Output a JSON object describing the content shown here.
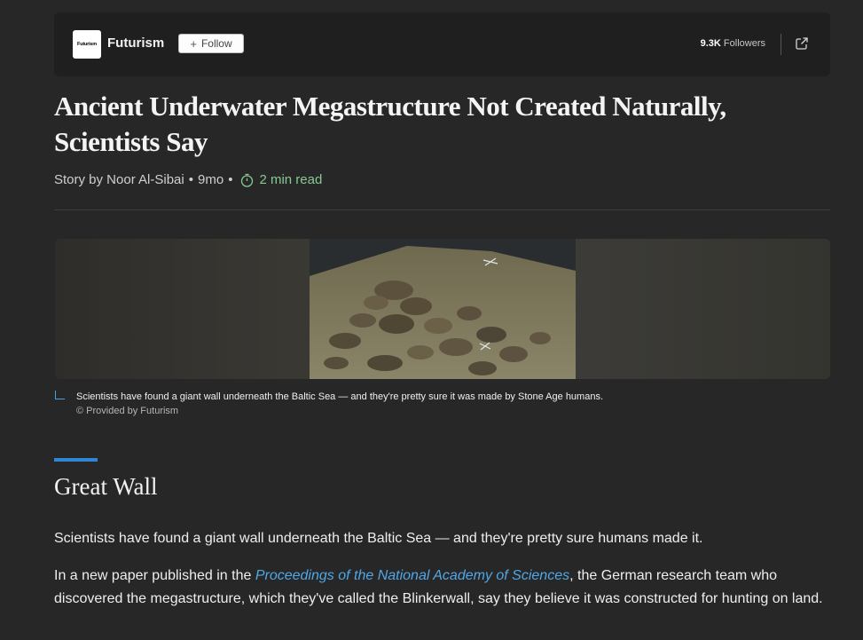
{
  "publisher": {
    "logo_text": "Futurism",
    "name": "Futurism",
    "follow_plus": "+",
    "follow_label": "Follow",
    "followers_count": "9.3K",
    "followers_label": "Followers"
  },
  "article": {
    "headline": "Ancient Underwater Megastructure Not Created Naturally, Scientists Say",
    "byline_author": "Story by Noor Al-Sibai",
    "separator": "•",
    "age": "9mo",
    "read_time": "2 min read"
  },
  "image": {
    "caption": "Scientists have found a giant wall underneath the Baltic Sea — and they're pretty sure it was made by Stone Age humans.",
    "credit": "© Provided by Futurism"
  },
  "body": {
    "section_heading": "Great Wall",
    "paragraph1": "Scientists have found a giant wall underneath the Baltic Sea — and they're pretty sure humans made it.",
    "paragraph2_prefix": "In a new paper published in the ",
    "paragraph2_link": "Proceedings of the National Academy of Sciences",
    "paragraph2_suffix": ", the German research team who discovered the megastructure, which they've called the Blinkerwall, say they believe it was constructed for hunting on land."
  },
  "colors": {
    "background": "#272727",
    "panel": "#1f1f1f",
    "accent": "#2f86d6",
    "read_time": "#86c995",
    "link": "#4fa8e8"
  },
  "icons": [
    "share-icon",
    "timer-icon",
    "caption-corner-icon",
    "plus-icon"
  ]
}
